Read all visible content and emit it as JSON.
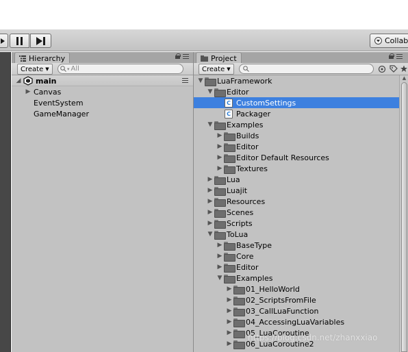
{
  "toolbar": {
    "pause_icon": "pause-icon",
    "step_icon": "step-icon",
    "collab_label": "Collab"
  },
  "hierarchy": {
    "tab_label": "Hierarchy",
    "create_label": "Create",
    "search_placeholder": "All",
    "scene_name": "main",
    "objects": [
      "Canvas",
      "EventSystem",
      "GameManager"
    ]
  },
  "project": {
    "tab_label": "Project",
    "create_label": "Create",
    "search_placeholder": "",
    "tree": [
      {
        "label": "LuaFramework",
        "depth": 0,
        "arrow": "open",
        "icon": "folder"
      },
      {
        "label": "Editor",
        "depth": 1,
        "arrow": "open",
        "icon": "folder"
      },
      {
        "label": "CustomSettings",
        "depth": 2,
        "arrow": "none",
        "icon": "script",
        "selected": true
      },
      {
        "label": "Packager",
        "depth": 2,
        "arrow": "none",
        "icon": "script"
      },
      {
        "label": "Examples",
        "depth": 1,
        "arrow": "open",
        "icon": "folder"
      },
      {
        "label": "Builds",
        "depth": 2,
        "arrow": "closed",
        "icon": "folder"
      },
      {
        "label": "Editor",
        "depth": 2,
        "arrow": "closed",
        "icon": "folder"
      },
      {
        "label": "Editor Default Resources",
        "depth": 2,
        "arrow": "closed",
        "icon": "folder"
      },
      {
        "label": "Textures",
        "depth": 2,
        "arrow": "closed",
        "icon": "folder"
      },
      {
        "label": "Lua",
        "depth": 1,
        "arrow": "closed",
        "icon": "folder"
      },
      {
        "label": "Luajit",
        "depth": 1,
        "arrow": "closed",
        "icon": "folder"
      },
      {
        "label": "Resources",
        "depth": 1,
        "arrow": "closed",
        "icon": "folder"
      },
      {
        "label": "Scenes",
        "depth": 1,
        "arrow": "closed",
        "icon": "folder"
      },
      {
        "label": "Scripts",
        "depth": 1,
        "arrow": "closed",
        "icon": "folder"
      },
      {
        "label": "ToLua",
        "depth": 1,
        "arrow": "open",
        "icon": "folder"
      },
      {
        "label": "BaseType",
        "depth": 2,
        "arrow": "closed",
        "icon": "folder"
      },
      {
        "label": "Core",
        "depth": 2,
        "arrow": "closed",
        "icon": "folder"
      },
      {
        "label": "Editor",
        "depth": 2,
        "arrow": "closed",
        "icon": "folder"
      },
      {
        "label": "Examples",
        "depth": 2,
        "arrow": "open",
        "icon": "folder"
      },
      {
        "label": "01_HelloWorld",
        "depth": 3,
        "arrow": "closed",
        "icon": "folder"
      },
      {
        "label": "02_ScriptsFromFile",
        "depth": 3,
        "arrow": "closed",
        "icon": "folder"
      },
      {
        "label": "03_CallLuaFunction",
        "depth": 3,
        "arrow": "closed",
        "icon": "folder"
      },
      {
        "label": "04_AccessingLuaVariables",
        "depth": 3,
        "arrow": "closed",
        "icon": "folder"
      },
      {
        "label": "05_LuaCoroutine",
        "depth": 3,
        "arrow": "closed",
        "icon": "folder"
      },
      {
        "label": "06_LuaCoroutine2",
        "depth": 3,
        "arrow": "closed",
        "icon": "folder"
      }
    ]
  },
  "watermark": "https://blog.csdn.net/zhanxxiao",
  "colors": {
    "selection": "#3d80df",
    "panel_bg": "#c2c2c2",
    "scene_dark": "#474747"
  }
}
